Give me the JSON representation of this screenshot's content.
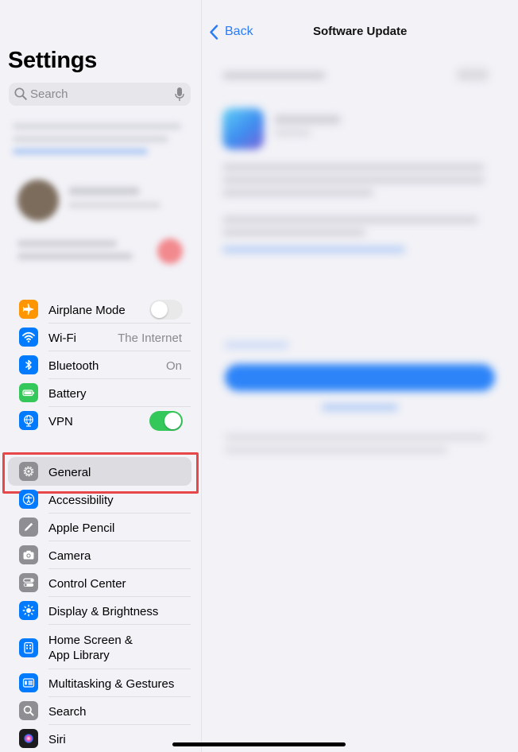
{
  "sidebar": {
    "title": "Settings",
    "search": {
      "placeholder": "Search"
    },
    "connectivity": [
      {
        "label": "Airplane Mode",
        "icon": "airplane-icon",
        "color": "#ff9500",
        "toggle": false
      },
      {
        "label": "Wi-Fi",
        "icon": "wifi-icon",
        "color": "#007aff",
        "value": "The Internet"
      },
      {
        "label": "Bluetooth",
        "icon": "bluetooth-icon",
        "color": "#007aff",
        "value": "On"
      },
      {
        "label": "Battery",
        "icon": "battery-icon",
        "color": "#34c759"
      },
      {
        "label": "VPN",
        "icon": "vpn-globe-icon",
        "color": "#007aff",
        "toggle": true
      }
    ],
    "system": [
      {
        "label": "General",
        "icon": "gear-icon",
        "color": "#8e8e93",
        "selected": true
      },
      {
        "label": "Accessibility",
        "icon": "accessibility-icon",
        "color": "#007aff"
      },
      {
        "label": "Apple Pencil",
        "icon": "pencil-icon",
        "color": "#8e8e93"
      },
      {
        "label": "Camera",
        "icon": "camera-icon",
        "color": "#8e8e93"
      },
      {
        "label": "Control Center",
        "icon": "control-center-icon",
        "color": "#8e8e93"
      },
      {
        "label": "Display & Brightness",
        "icon": "sun-icon",
        "color": "#007aff"
      },
      {
        "label": "Home Screen &",
        "label2": "App Library",
        "icon": "home-screen-icon",
        "color": "#007aff"
      },
      {
        "label": "Multitasking & Gestures",
        "icon": "multitasking-icon",
        "color": "#007aff"
      },
      {
        "label": "Search",
        "icon": "magnifier-icon",
        "color": "#8e8e93"
      },
      {
        "label": "Siri",
        "icon": "siri-icon",
        "color": "#1c1c1e"
      }
    ]
  },
  "detail": {
    "back_label": "Back",
    "title": "Software Update"
  },
  "colors": {
    "accent": "#2a7cf6",
    "toggle_on": "#34c759",
    "highlight": "#e8474a"
  }
}
